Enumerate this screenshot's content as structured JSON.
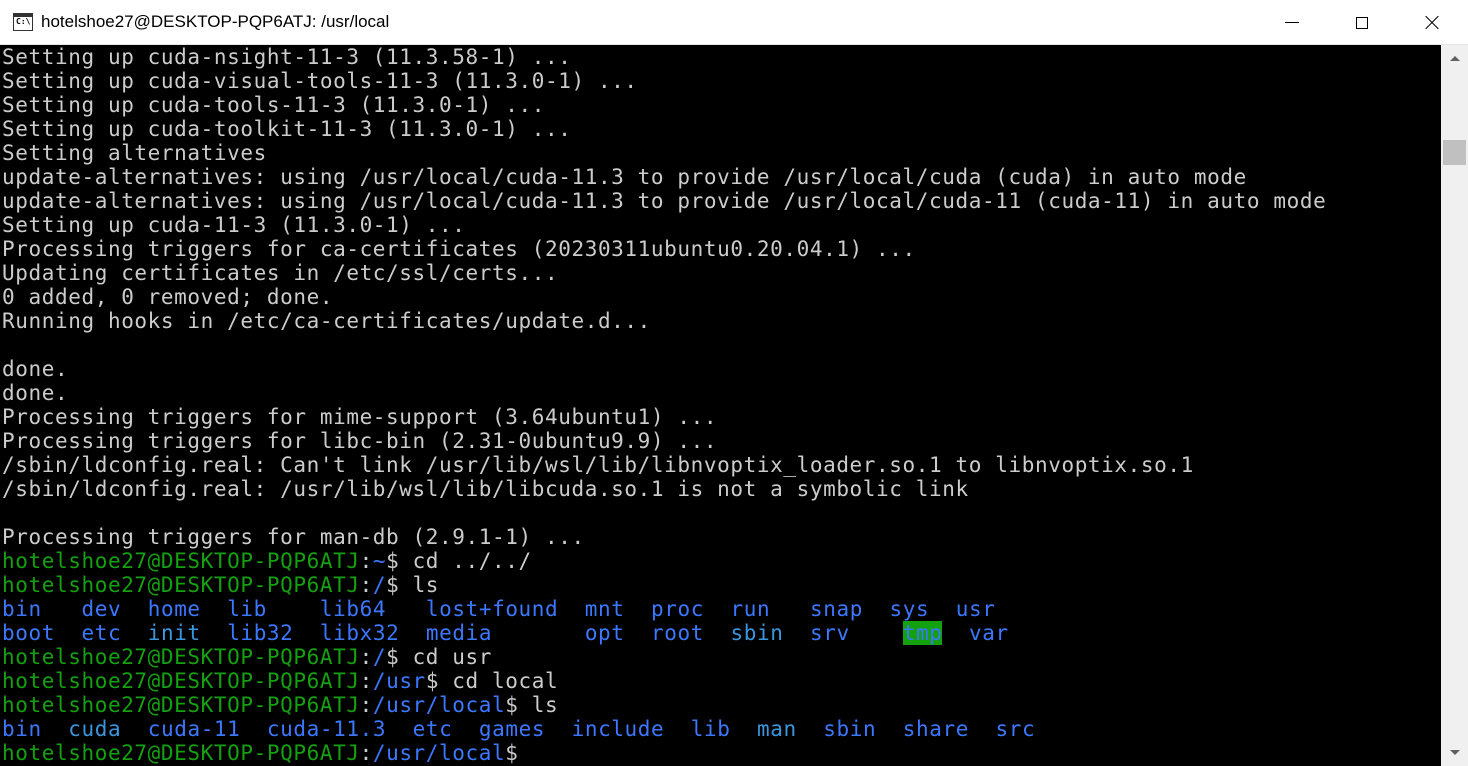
{
  "window": {
    "title": "hotelshoe27@DESKTOP-PQP6ATJ: /usr/local",
    "icon_text": "C:\\",
    "icons": {
      "app": "console-icon",
      "minimize": "minimize-icon",
      "maximize": "maximize-icon",
      "close": "close-icon",
      "scroll_up": "chevron-up-icon",
      "scroll_down": "chevron-down-icon"
    }
  },
  "colors": {
    "prompt_user": "#13a10e",
    "prompt_path": "#3b78ff",
    "dir": "#3b78ff",
    "text": "#cccccc",
    "sticky_dir_bg": "#13a10e",
    "background": "#000000"
  },
  "terminal": {
    "lines": [
      [
        [
          "Setting up cuda-nsight-11-3 (11.3.58-1) ...",
          "w"
        ]
      ],
      [
        [
          "Setting up cuda-visual-tools-11-3 (11.3.0-1) ...",
          "w"
        ]
      ],
      [
        [
          "Setting up cuda-tools-11-3 (11.3.0-1) ...",
          "w"
        ]
      ],
      [
        [
          "Setting up cuda-toolkit-11-3 (11.3.0-1) ...",
          "w"
        ]
      ],
      [
        [
          "Setting alternatives",
          "w"
        ]
      ],
      [
        [
          "update-alternatives: using /usr/local/cuda-11.3 to provide /usr/local/cuda (cuda) in auto mode",
          "w"
        ]
      ],
      [
        [
          "update-alternatives: using /usr/local/cuda-11.3 to provide /usr/local/cuda-11 (cuda-11) in auto mode",
          "w"
        ]
      ],
      [
        [
          "Setting up cuda-11-3 (11.3.0-1) ...",
          "w"
        ]
      ],
      [
        [
          "Processing triggers for ca-certificates (20230311ubuntu0.20.04.1) ...",
          "w"
        ]
      ],
      [
        [
          "Updating certificates in /etc/ssl/certs...",
          "w"
        ]
      ],
      [
        [
          "0 added, 0 removed; done.",
          "w"
        ]
      ],
      [
        [
          "Running hooks in /etc/ca-certificates/update.d...",
          "w"
        ]
      ],
      [
        [
          "",
          "w"
        ]
      ],
      [
        [
          "done.",
          "w"
        ]
      ],
      [
        [
          "done.",
          "w"
        ]
      ],
      [
        [
          "Processing triggers for mime-support (3.64ubuntu1) ...",
          "w"
        ]
      ],
      [
        [
          "Processing triggers for libc-bin (2.31-0ubuntu9.9) ...",
          "w"
        ]
      ],
      [
        [
          "/sbin/ldconfig.real: Can't link /usr/lib/wsl/lib/libnvoptix_loader.so.1 to libnvoptix.so.1",
          "w"
        ]
      ],
      [
        [
          "/sbin/ldconfig.real: /usr/lib/wsl/lib/libcuda.so.1 is not a symbolic link",
          "w"
        ]
      ],
      [
        [
          "",
          "w"
        ]
      ],
      [
        [
          "Processing triggers for man-db (2.9.1-1) ...",
          "w"
        ]
      ],
      [
        [
          "hotelshoe27@DESKTOP-PQP6ATJ",
          "g"
        ],
        [
          ":",
          "w"
        ],
        [
          "~",
          "b"
        ],
        [
          "$ cd ../../",
          "w"
        ]
      ],
      [
        [
          "hotelshoe27@DESKTOP-PQP6ATJ",
          "g"
        ],
        [
          ":",
          "w"
        ],
        [
          "/",
          "b"
        ],
        [
          "$ ls",
          "w"
        ]
      ],
      [
        [
          "bin",
          "b"
        ],
        [
          "   ",
          "w"
        ],
        [
          "dev",
          "b"
        ],
        [
          "  ",
          "w"
        ],
        [
          "home",
          "b"
        ],
        [
          "  ",
          "w"
        ],
        [
          "lib",
          "b"
        ],
        [
          "    ",
          "w"
        ],
        [
          "lib64",
          "b"
        ],
        [
          "   ",
          "w"
        ],
        [
          "lost+found",
          "b"
        ],
        [
          "  ",
          "w"
        ],
        [
          "mnt",
          "b"
        ],
        [
          "  ",
          "w"
        ],
        [
          "proc",
          "b"
        ],
        [
          "  ",
          "w"
        ],
        [
          "run",
          "b"
        ],
        [
          "   ",
          "w"
        ],
        [
          "snap",
          "b"
        ],
        [
          "  ",
          "w"
        ],
        [
          "sys",
          "b"
        ],
        [
          "  ",
          "w"
        ],
        [
          "usr",
          "b"
        ]
      ],
      [
        [
          "boot",
          "b"
        ],
        [
          "  ",
          "w"
        ],
        [
          "etc",
          "b"
        ],
        [
          "  ",
          "w"
        ],
        [
          "init",
          "c"
        ],
        [
          "  ",
          "w"
        ],
        [
          "lib32",
          "b"
        ],
        [
          "  ",
          "w"
        ],
        [
          "libx32",
          "b"
        ],
        [
          "  ",
          "w"
        ],
        [
          "media",
          "b"
        ],
        [
          "       ",
          "w"
        ],
        [
          "opt",
          "b"
        ],
        [
          "  ",
          "w"
        ],
        [
          "root",
          "b"
        ],
        [
          "  ",
          "w"
        ],
        [
          "sbin",
          "c"
        ],
        [
          "  ",
          "w"
        ],
        [
          "srv",
          "b"
        ],
        [
          "    ",
          "w"
        ],
        [
          "tmp",
          "hl"
        ],
        [
          "  ",
          "w"
        ],
        [
          "var",
          "b"
        ]
      ],
      [
        [
          "hotelshoe27@DESKTOP-PQP6ATJ",
          "g"
        ],
        [
          ":",
          "w"
        ],
        [
          "/",
          "b"
        ],
        [
          "$ cd usr",
          "w"
        ]
      ],
      [
        [
          "hotelshoe27@DESKTOP-PQP6ATJ",
          "g"
        ],
        [
          ":",
          "w"
        ],
        [
          "/usr",
          "b"
        ],
        [
          "$ cd local",
          "w"
        ]
      ],
      [
        [
          "hotelshoe27@DESKTOP-PQP6ATJ",
          "g"
        ],
        [
          ":",
          "w"
        ],
        [
          "/usr/local",
          "b"
        ],
        [
          "$ ls",
          "w"
        ]
      ],
      [
        [
          "bin",
          "b"
        ],
        [
          "  ",
          "w"
        ],
        [
          "cuda",
          "c"
        ],
        [
          "  ",
          "w"
        ],
        [
          "cuda-11",
          "b"
        ],
        [
          "  ",
          "w"
        ],
        [
          "cuda-11.3",
          "b"
        ],
        [
          "  ",
          "w"
        ],
        [
          "etc",
          "b"
        ],
        [
          "  ",
          "w"
        ],
        [
          "games",
          "b"
        ],
        [
          "  ",
          "w"
        ],
        [
          "include",
          "b"
        ],
        [
          "  ",
          "w"
        ],
        [
          "lib",
          "b"
        ],
        [
          "  ",
          "w"
        ],
        [
          "man",
          "c"
        ],
        [
          "  ",
          "w"
        ],
        [
          "sbin",
          "b"
        ],
        [
          "  ",
          "w"
        ],
        [
          "share",
          "b"
        ],
        [
          "  ",
          "w"
        ],
        [
          "src",
          "b"
        ]
      ],
      [
        [
          "hotelshoe27@DESKTOP-PQP6ATJ",
          "g"
        ],
        [
          ":",
          "w"
        ],
        [
          "/usr/local",
          "b"
        ],
        [
          "$",
          "w"
        ]
      ]
    ]
  }
}
